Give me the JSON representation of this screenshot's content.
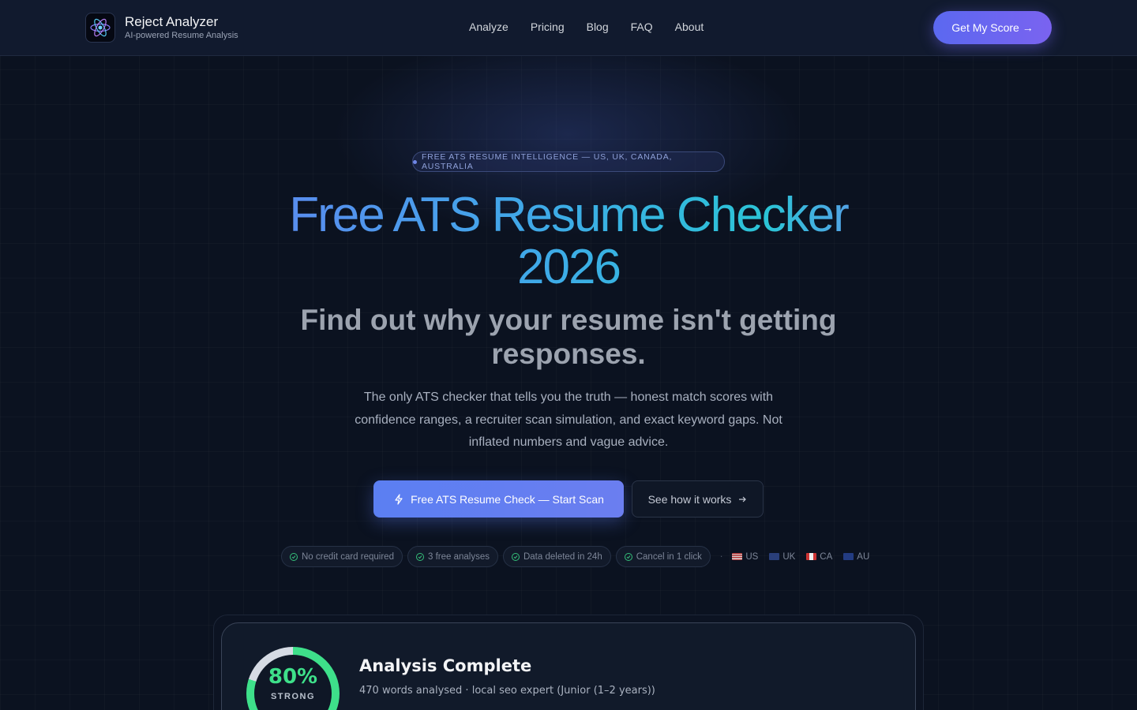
{
  "header": {
    "brand_name": "Reject Analyzer",
    "brand_tagline": "AI-powered Resume Analysis",
    "nav": [
      "Analyze",
      "Pricing",
      "Blog",
      "FAQ",
      "About"
    ],
    "cta": "Get My Score →"
  },
  "hero": {
    "pill": "FREE ATS RESUME INTELLIGENCE — US, UK, CANADA, AUSTRALIA",
    "title": "Free ATS Resume Checker 2026",
    "subtitle": "Find out why your resume isn't getting responses.",
    "description": "The only ATS checker that tells you the truth — honest match scores with confidence ranges, a recruiter scan simulation, and exact keyword gaps. Not inflated numbers and vague advice.",
    "primary_button": "Free ATS Resume Check — Start Scan",
    "secondary_button": "See how it works",
    "badges": [
      "No credit card required",
      "3 free analyses",
      "Data deleted in 24h",
      "Cancel in 1 click"
    ],
    "regions": [
      "US",
      "UK",
      "CA",
      "AU"
    ]
  },
  "analysis": {
    "score": "80%",
    "score_value": 80,
    "score_label": "STRONG",
    "title": "Analysis Complete",
    "meta": "470 words analysed · local seo expert (Junior (1–2 years))"
  },
  "colors": {
    "accent": "#5b68f0",
    "score_green": "#3ee08a",
    "background": "#0b1220"
  }
}
